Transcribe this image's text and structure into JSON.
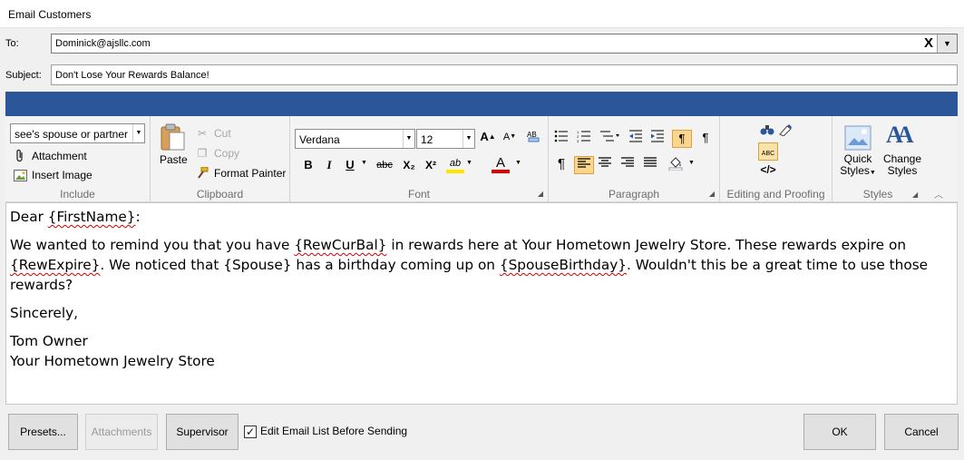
{
  "window": {
    "title": "Email Customers"
  },
  "to": {
    "label": "To:",
    "value": "Dominick@ajsllc.com",
    "clear_glyph": "X",
    "dropdown_glyph": "▼"
  },
  "subject": {
    "label": "Subject:",
    "value": "Don't Lose Your Rewards Balance!"
  },
  "ribbon": {
    "include": {
      "label": "Include",
      "dropdown_value": "see's spouse or partner",
      "attachment": "Attachment",
      "insert_image": "Insert Image"
    },
    "clipboard": {
      "label": "Clipboard",
      "paste": "Paste",
      "cut": "Cut",
      "copy": "Copy",
      "format_painter": "Format Painter"
    },
    "font": {
      "label": "Font",
      "family": "Verdana",
      "size": "12",
      "bold": "B",
      "italic": "I",
      "underline": "U",
      "strike": "abc",
      "subscript": "X₂",
      "superscript": "X²",
      "highlight": "ab",
      "font_color": "A",
      "grow": "A",
      "shrink": "A"
    },
    "paragraph": {
      "label": "Paragraph",
      "pilcrow": "¶"
    },
    "editing": {
      "label": "Editing and Proofing",
      "spell": "ABC",
      "html": "</>"
    },
    "styles": {
      "label": "Styles",
      "quick_styles": [
        "Quick",
        "Styles"
      ],
      "change_styles": [
        "Change",
        "Styles"
      ],
      "change_icon_letters": "AA"
    }
  },
  "body": {
    "greeting_prefix": "Dear ",
    "greeting_token": "{FirstName}",
    "greeting_suffix": ":",
    "p1_a": "We wanted to remind you that you have ",
    "p1_token1": "{RewCurBal}",
    "p1_b": " in rewards here at Your Hometown Jewelry Store.  These rewards expire on ",
    "p1_token2": "{RewExpire}",
    "p1_c": ".  We noticed that {Spouse} has a birthday coming up on ",
    "p1_token3": "{SpouseBirthday}",
    "p1_d": ".  Wouldn't this be a great time to use those rewards?",
    "closing": "Sincerely,",
    "signature_name": "Tom Owner",
    "signature_store": "Your Hometown Jewelry Store"
  },
  "footer": {
    "presets": "Presets...",
    "attachments": "Attachments",
    "supervisor": "Supervisor",
    "edit_list_label": "Edit Email List Before Sending",
    "edit_list_checked": true,
    "check_glyph": "✓",
    "ok": "OK",
    "cancel": "Cancel"
  },
  "colors": {
    "ribbon_band": "#2b579a",
    "active_toggle": "#fcd68c"
  }
}
